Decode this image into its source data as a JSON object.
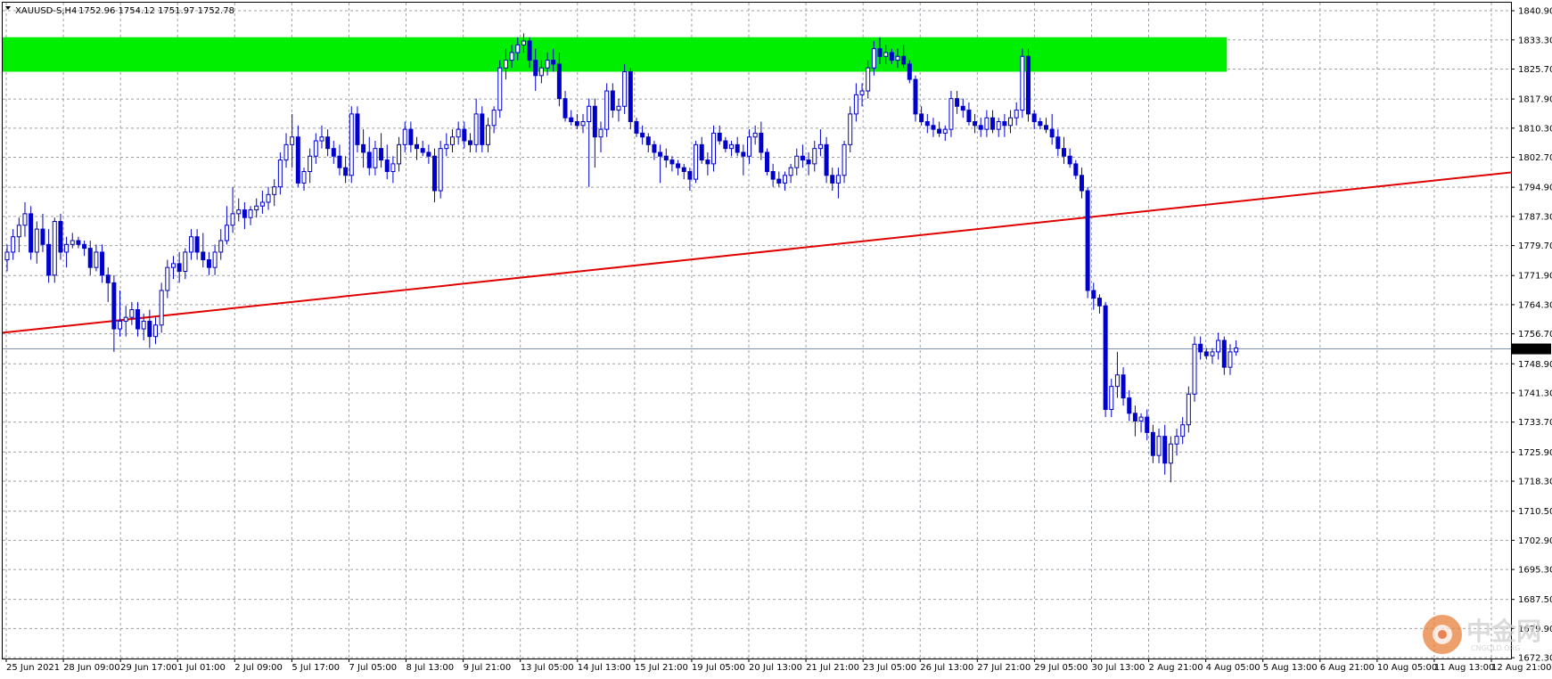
{
  "header": {
    "symbol": "XAUUSD-S,H4",
    "ohlc": "1752.96 1754.12 1751.97 1752.78"
  },
  "colors": {
    "candle": "#0000cc",
    "grid": "#9aa0a8",
    "zone": "#00ee00",
    "trendline": "#e00000",
    "price_line": "#8090b0",
    "price_tag_bg": "#000000",
    "price_tag_fg": "#ffffff"
  },
  "chart_data": {
    "type": "candlestick",
    "title": "",
    "symbol": "XAUUSD-S",
    "timeframe": "H4",
    "ylim": [
      1672.1,
      1843.0
    ],
    "y_ticks": [
      "1840.90",
      "1833.30",
      "1825.70",
      "1817.90",
      "1810.30",
      "1802.70",
      "1794.90",
      "1787.30",
      "1779.70",
      "1771.90",
      "1764.30",
      "1756.70",
      "1748.90",
      "1741.30",
      "1733.70",
      "1725.90",
      "1718.30",
      "1710.50",
      "1702.90",
      "1695.30",
      "1687.50",
      "1679.90",
      "1672.30"
    ],
    "x_labels": [
      "25 Jun 2021",
      "28 Jun 09:00",
      "29 Jun 17:00",
      "1 Jul 01:00",
      "2 Jul 09:00",
      "5 Jul 17:00",
      "7 Jul 05:00",
      "8 Jul 13:00",
      "9 Jul 21:00",
      "13 Jul 05:00",
      "14 Jul 13:00",
      "15 Jul 21:00",
      "19 Jul 05:00",
      "20 Jul 13:00",
      "21 Jul 21:00",
      "23 Jul 05:00",
      "26 Jul 13:00",
      "27 Jul 21:00",
      "29 Jul 05:00",
      "30 Jul 13:00",
      "2 Aug 21:00",
      "4 Aug 05:00",
      "5 Aug 13:00",
      "6 Aug 21:00",
      "10 Aug 05:00",
      "11 Aug 13:00",
      "12 Aug 21:00"
    ],
    "current_price": 1752.78,
    "resistance_zone": {
      "low": 1825.0,
      "high": 1834.0,
      "from_bar": 0,
      "to_bar": 205
    },
    "trendline": {
      "from_bar": 0,
      "from_price": 1757.0,
      "to_bar": 253,
      "to_price": 1798.6
    },
    "ohlc": [
      [
        1776,
        1780,
        1773,
        1778
      ],
      [
        1778,
        1784,
        1776,
        1782
      ],
      [
        1782,
        1787,
        1778,
        1785
      ],
      [
        1785,
        1791,
        1782,
        1788
      ],
      [
        1788,
        1790,
        1776,
        1778
      ],
      [
        1778,
        1786,
        1775,
        1784
      ],
      [
        1784,
        1788,
        1778,
        1780
      ],
      [
        1780,
        1784,
        1770,
        1772
      ],
      [
        1772,
        1787,
        1770,
        1786
      ],
      [
        1786,
        1788,
        1776,
        1778
      ],
      [
        1778,
        1782,
        1774,
        1780
      ],
      [
        1780,
        1783,
        1779,
        1781
      ],
      [
        1781,
        1782,
        1779,
        1780
      ],
      [
        1780,
        1781,
        1777,
        1779
      ],
      [
        1779,
        1781,
        1772,
        1774
      ],
      [
        1774,
        1780,
        1773,
        1778
      ],
      [
        1778,
        1780,
        1770,
        1772
      ],
      [
        1772,
        1774,
        1765,
        1770
      ],
      [
        1770,
        1772,
        1752,
        1758
      ],
      [
        1758,
        1768,
        1756,
        1760
      ],
      [
        1760,
        1764,
        1756,
        1761
      ],
      [
        1761,
        1765,
        1759,
        1763
      ],
      [
        1763,
        1765,
        1756,
        1758
      ],
      [
        1758,
        1762,
        1755,
        1760
      ],
      [
        1760,
        1763,
        1753,
        1756
      ],
      [
        1756,
        1761,
        1754,
        1759
      ],
      [
        1759,
        1770,
        1757,
        1768
      ],
      [
        1768,
        1776,
        1766,
        1774
      ],
      [
        1774,
        1777,
        1771,
        1775
      ],
      [
        1775,
        1778,
        1770,
        1773
      ],
      [
        1773,
        1779,
        1771,
        1778
      ],
      [
        1778,
        1784,
        1776,
        1782
      ],
      [
        1782,
        1784,
        1776,
        1778
      ],
      [
        1778,
        1783,
        1774,
        1776
      ],
      [
        1776,
        1778,
        1772,
        1774
      ],
      [
        1774,
        1780,
        1772,
        1778
      ],
      [
        1778,
        1784,
        1776,
        1781
      ],
      [
        1781,
        1790,
        1780,
        1785
      ],
      [
        1785,
        1795,
        1783,
        1788
      ],
      [
        1788,
        1792,
        1786,
        1789
      ],
      [
        1789,
        1791,
        1784,
        1787
      ],
      [
        1787,
        1790,
        1785,
        1789
      ],
      [
        1789,
        1792,
        1787,
        1790
      ],
      [
        1790,
        1794,
        1788,
        1791
      ],
      [
        1791,
        1795,
        1789,
        1793
      ],
      [
        1793,
        1797,
        1790,
        1795
      ],
      [
        1795,
        1804,
        1793,
        1802
      ],
      [
        1802,
        1809,
        1800,
        1806
      ],
      [
        1806,
        1814,
        1800,
        1808
      ],
      [
        1808,
        1811,
        1795,
        1796
      ],
      [
        1796,
        1800,
        1794,
        1799
      ],
      [
        1799,
        1805,
        1796,
        1803
      ],
      [
        1803,
        1809,
        1801,
        1807
      ],
      [
        1807,
        1811,
        1805,
        1808
      ],
      [
        1808,
        1810,
        1803,
        1805
      ],
      [
        1805,
        1807,
        1801,
        1803
      ],
      [
        1803,
        1806,
        1798,
        1800
      ],
      [
        1800,
        1803,
        1796,
        1798
      ],
      [
        1798,
        1816,
        1796,
        1814
      ],
      [
        1814,
        1816,
        1804,
        1806
      ],
      [
        1806,
        1810,
        1800,
        1804
      ],
      [
        1804,
        1808,
        1798,
        1800
      ],
      [
        1800,
        1807,
        1798,
        1805
      ],
      [
        1805,
        1809,
        1800,
        1802
      ],
      [
        1802,
        1806,
        1797,
        1799
      ],
      [
        1799,
        1803,
        1796,
        1801
      ],
      [
        1801,
        1808,
        1799,
        1806
      ],
      [
        1806,
        1812,
        1804,
        1810
      ],
      [
        1810,
        1812,
        1804,
        1806
      ],
      [
        1806,
        1808,
        1802,
        1805
      ],
      [
        1805,
        1807,
        1803,
        1804
      ],
      [
        1804,
        1806,
        1801,
        1803
      ],
      [
        1803,
        1805,
        1791,
        1794
      ],
      [
        1794,
        1807,
        1792,
        1805
      ],
      [
        1805,
        1809,
        1803,
        1806
      ],
      [
        1806,
        1810,
        1804,
        1808
      ],
      [
        1808,
        1812,
        1806,
        1810
      ],
      [
        1810,
        1812,
        1805,
        1807
      ],
      [
        1807,
        1809,
        1804,
        1806
      ],
      [
        1806,
        1818,
        1804,
        1814
      ],
      [
        1814,
        1816,
        1804,
        1806
      ],
      [
        1806,
        1813,
        1804,
        1811
      ],
      [
        1811,
        1816,
        1809,
        1815
      ],
      [
        1815,
        1828,
        1813,
        1826
      ],
      [
        1826,
        1831,
        1823,
        1828
      ],
      [
        1828,
        1832,
        1826,
        1830
      ],
      [
        1830,
        1834,
        1828,
        1832
      ],
      [
        1832,
        1835,
        1830,
        1833
      ],
      [
        1833,
        1834,
        1826,
        1828
      ],
      [
        1828,
        1831,
        1820,
        1824
      ],
      [
        1824,
        1828,
        1822,
        1826
      ],
      [
        1826,
        1830,
        1824,
        1828
      ],
      [
        1828,
        1831,
        1825,
        1827
      ],
      [
        1827,
        1830,
        1816,
        1818
      ],
      [
        1818,
        1820,
        1812,
        1813
      ],
      [
        1813,
        1815,
        1811,
        1812
      ],
      [
        1812,
        1814,
        1810,
        1811
      ],
      [
        1811,
        1814,
        1809,
        1812
      ],
      [
        1812,
        1818,
        1795,
        1816
      ],
      [
        1816,
        1818,
        1800,
        1808
      ],
      [
        1808,
        1812,
        1804,
        1810
      ],
      [
        1810,
        1822,
        1808,
        1820
      ],
      [
        1820,
        1822,
        1813,
        1815
      ],
      [
        1815,
        1818,
        1812,
        1816
      ],
      [
        1816,
        1827,
        1814,
        1825
      ],
      [
        1825,
        1826,
        1810,
        1812
      ],
      [
        1812,
        1813,
        1808,
        1809
      ],
      [
        1809,
        1811,
        1806,
        1808
      ],
      [
        1808,
        1809,
        1804,
        1806
      ],
      [
        1806,
        1807,
        1802,
        1804
      ],
      [
        1804,
        1806,
        1796,
        1803
      ],
      [
        1803,
        1805,
        1800,
        1802
      ],
      [
        1802,
        1803,
        1799,
        1801
      ],
      [
        1801,
        1802,
        1798,
        1800
      ],
      [
        1800,
        1801,
        1797,
        1799
      ],
      [
        1799,
        1800,
        1794,
        1797
      ],
      [
        1797,
        1807,
        1796,
        1806
      ],
      [
        1806,
        1808,
        1801,
        1802
      ],
      [
        1802,
        1804,
        1798,
        1801
      ],
      [
        1801,
        1811,
        1799,
        1809
      ],
      [
        1809,
        1811,
        1806,
        1807
      ],
      [
        1807,
        1808,
        1804,
        1805
      ],
      [
        1805,
        1807,
        1803,
        1806
      ],
      [
        1806,
        1808,
        1803,
        1804
      ],
      [
        1804,
        1806,
        1798,
        1803
      ],
      [
        1803,
        1810,
        1801,
        1808
      ],
      [
        1808,
        1811,
        1806,
        1809
      ],
      [
        1809,
        1812,
        1802,
        1804
      ],
      [
        1804,
        1805,
        1798,
        1799
      ],
      [
        1799,
        1801,
        1795,
        1797
      ],
      [
        1797,
        1799,
        1795,
        1796
      ],
      [
        1796,
        1799,
        1794,
        1798
      ],
      [
        1798,
        1801,
        1796,
        1800
      ],
      [
        1800,
        1805,
        1798,
        1803
      ],
      [
        1803,
        1806,
        1800,
        1802
      ],
      [
        1802,
        1804,
        1798,
        1801
      ],
      [
        1801,
        1807,
        1799,
        1805
      ],
      [
        1805,
        1810,
        1803,
        1806
      ],
      [
        1806,
        1808,
        1796,
        1798
      ],
      [
        1798,
        1800,
        1794,
        1796
      ],
      [
        1796,
        1800,
        1792,
        1798
      ],
      [
        1798,
        1807,
        1796,
        1806
      ],
      [
        1806,
        1816,
        1804,
        1814
      ],
      [
        1814,
        1822,
        1812,
        1819
      ],
      [
        1819,
        1822,
        1816,
        1820
      ],
      [
        1820,
        1828,
        1818,
        1826
      ],
      [
        1826,
        1833,
        1824,
        1831
      ],
      [
        1831,
        1834,
        1827,
        1829
      ],
      [
        1829,
        1832,
        1827,
        1830
      ],
      [
        1830,
        1831,
        1827,
        1828
      ],
      [
        1828,
        1831,
        1826,
        1829
      ],
      [
        1829,
        1832,
        1826,
        1827
      ],
      [
        1827,
        1828,
        1822,
        1823
      ],
      [
        1823,
        1824,
        1812,
        1814
      ],
      [
        1814,
        1816,
        1811,
        1812
      ],
      [
        1812,
        1814,
        1809,
        1811
      ],
      [
        1811,
        1813,
        1808,
        1810
      ],
      [
        1810,
        1812,
        1808,
        1809
      ],
      [
        1809,
        1811,
        1807,
        1810
      ],
      [
        1810,
        1820,
        1808,
        1818
      ],
      [
        1818,
        1820,
        1814,
        1816
      ],
      [
        1816,
        1818,
        1813,
        1815
      ],
      [
        1815,
        1817,
        1811,
        1812
      ],
      [
        1812,
        1814,
        1809,
        1811
      ],
      [
        1811,
        1813,
        1808,
        1810
      ],
      [
        1810,
        1815,
        1808,
        1813
      ],
      [
        1813,
        1815,
        1809,
        1810
      ],
      [
        1810,
        1813,
        1808,
        1812
      ],
      [
        1812,
        1814,
        1808,
        1811
      ],
      [
        1811,
        1815,
        1809,
        1813
      ],
      [
        1813,
        1817,
        1811,
        1815
      ],
      [
        1815,
        1831,
        1813,
        1829
      ],
      [
        1829,
        1831,
        1812,
        1814
      ],
      [
        1814,
        1815,
        1810,
        1812
      ],
      [
        1812,
        1813,
        1810,
        1811
      ],
      [
        1811,
        1813,
        1809,
        1810
      ],
      [
        1810,
        1814,
        1806,
        1808
      ],
      [
        1808,
        1810,
        1803,
        1805
      ],
      [
        1805,
        1808,
        1801,
        1803
      ],
      [
        1803,
        1805,
        1800,
        1801
      ],
      [
        1801,
        1802,
        1797,
        1798
      ],
      [
        1798,
        1800,
        1792,
        1794
      ],
      [
        1794,
        1795,
        1766,
        1768
      ],
      [
        1768,
        1770,
        1763,
        1766
      ],
      [
        1766,
        1767,
        1762,
        1764
      ],
      [
        1764,
        1765,
        1735,
        1737
      ],
      [
        1737,
        1745,
        1735,
        1743
      ],
      [
        1743,
        1752,
        1740,
        1746
      ],
      [
        1746,
        1748,
        1738,
        1740
      ],
      [
        1740,
        1742,
        1734,
        1736
      ],
      [
        1736,
        1738,
        1730,
        1734
      ],
      [
        1734,
        1736,
        1731,
        1735
      ],
      [
        1735,
        1737,
        1729,
        1731
      ],
      [
        1731,
        1733,
        1723,
        1725
      ],
      [
        1725,
        1732,
        1723,
        1730
      ],
      [
        1730,
        1733,
        1720,
        1723
      ],
      [
        1723,
        1730,
        1718,
        1728
      ],
      [
        1728,
        1732,
        1725,
        1730
      ],
      [
        1730,
        1735,
        1728,
        1733
      ],
      [
        1733,
        1743,
        1731,
        1741
      ],
      [
        1741,
        1756,
        1739,
        1754
      ],
      [
        1754,
        1756,
        1750,
        1752
      ],
      [
        1752,
        1753,
        1750,
        1751
      ],
      [
        1751,
        1753,
        1749,
        1752
      ],
      [
        1752,
        1757,
        1750,
        1755
      ],
      [
        1755,
        1756,
        1746,
        1748
      ],
      [
        1748,
        1754,
        1746,
        1752
      ],
      [
        1752,
        1755,
        1751,
        1753
      ]
    ]
  },
  "watermark": {
    "brand": "中金网",
    "domain": "CNGOLD.ORG"
  }
}
